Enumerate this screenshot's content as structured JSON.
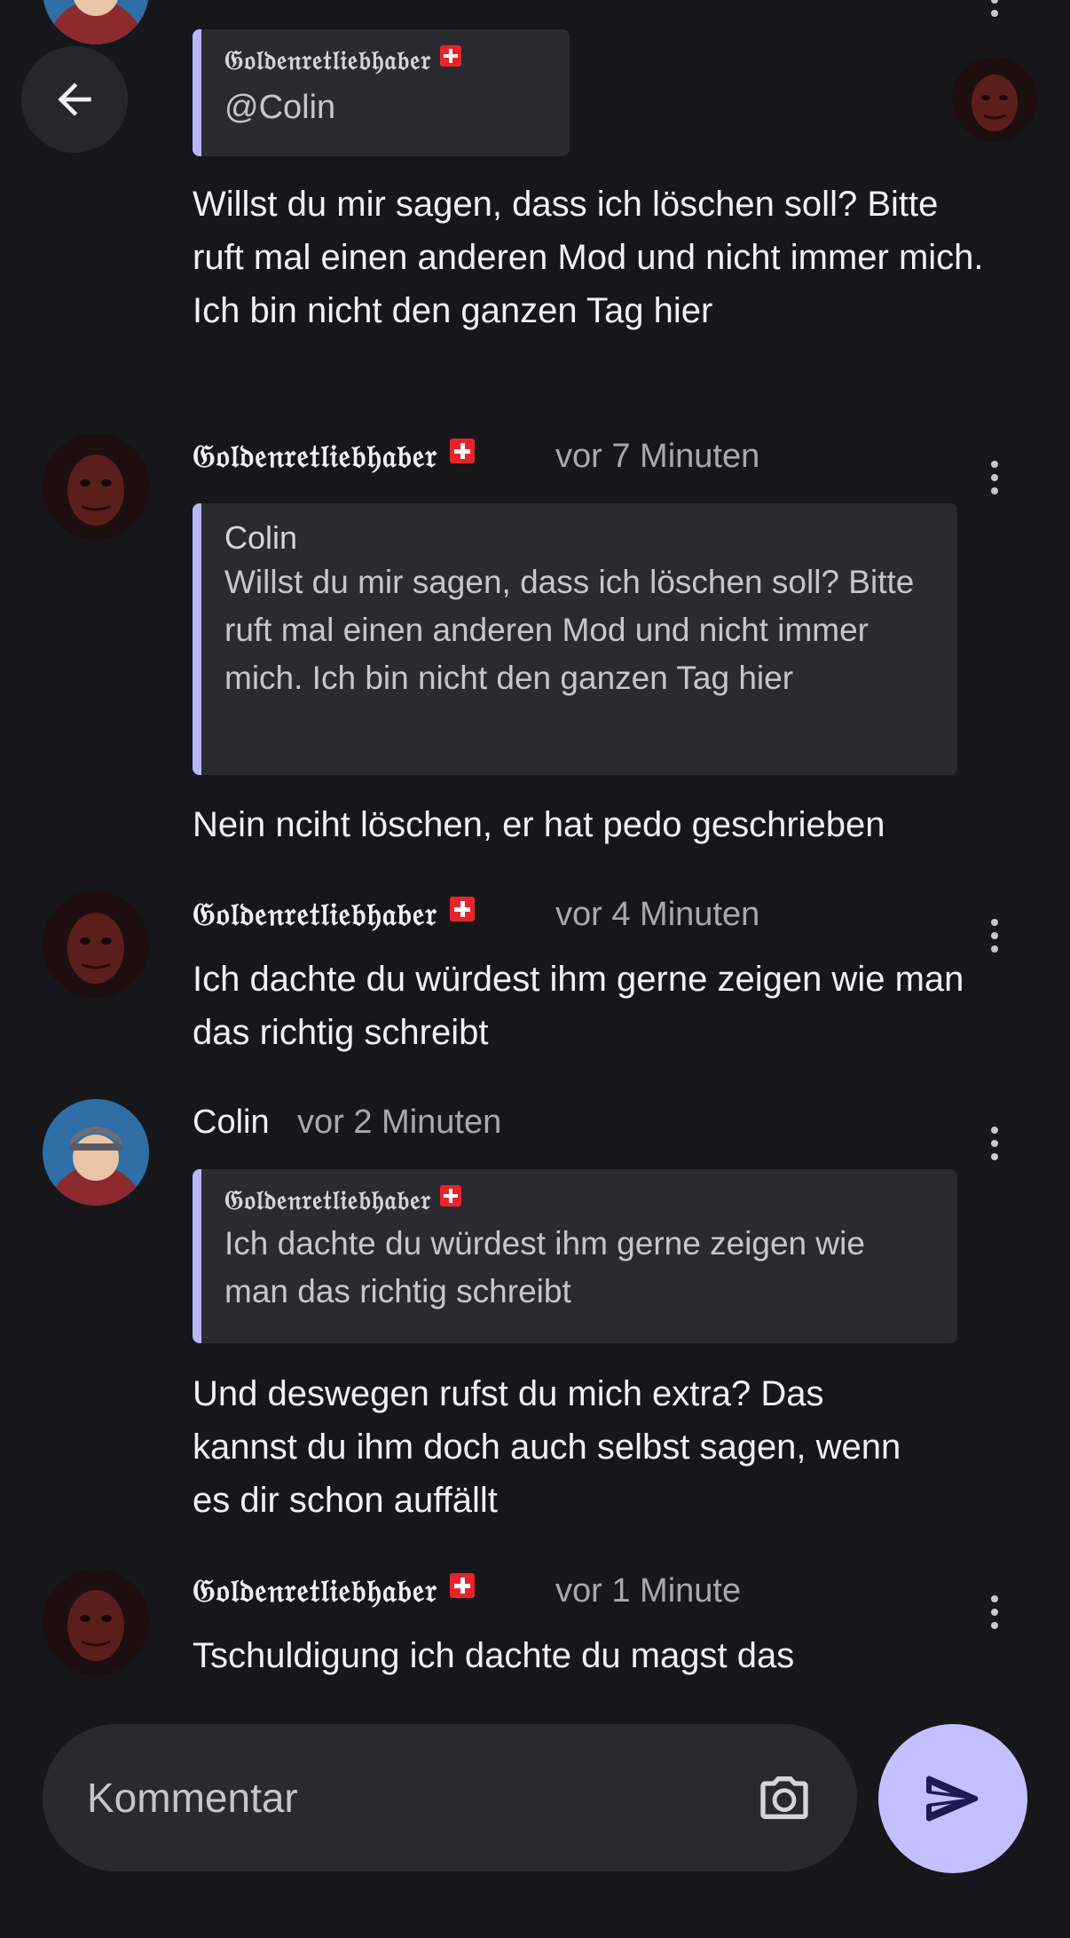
{
  "comments": [
    {
      "author": "𝔊𝔬𝔩𝔡𝔢𝔫𝔯𝔢𝔱𝔩𝔦𝔢𝔟𝔥𝔞𝔟𝔢𝔯",
      "quote_author": "𝔊𝔬𝔩𝔡𝔢𝔫𝔯𝔢𝔱𝔩𝔦𝔢𝔟𝔥𝔞𝔟𝔢𝔯",
      "quote_text": "@Colin",
      "text": "Willst du mir sagen, dass ich löschen soll? Bitte ruft mal einen anderen Mod und nicht immer mich. Ich bin nicht den ganzen Tag hier"
    },
    {
      "author": "𝔊𝔬𝔩𝔡𝔢𝔫𝔯𝔢𝔱𝔩𝔦𝔢𝔟𝔥𝔞𝔟𝔢𝔯",
      "time": "vor 7 Minuten",
      "quote_author": "Colin",
      "quote_text": "Willst du mir sagen, dass ich löschen soll? Bitte ruft mal einen anderen Mod und nicht immer mich. Ich bin nicht den ganzen Tag hier",
      "text": "Nein nciht löschen, er hat pedo geschrieben"
    },
    {
      "author": "𝔊𝔬𝔩𝔡𝔢𝔫𝔯𝔢𝔱𝔩𝔦𝔢𝔟𝔥𝔞𝔟𝔢𝔯",
      "time": "vor 4 Minuten",
      "text": "Ich dachte du würdest ihm gerne zeigen wie man das richtig schreibt"
    },
    {
      "author": "Colin",
      "time": "vor 2 Minuten",
      "quote_author": "𝔊𝔬𝔩𝔡𝔢𝔫𝔯𝔢𝔱𝔩𝔦𝔢𝔟𝔥𝔞𝔟𝔢𝔯",
      "quote_text": "Ich dachte du würdest ihm gerne zeigen wie man das richtig schreibt",
      "text": "Und deswegen rufst du mich extra? Das kannst du ihm doch auch selbst sagen, wenn es dir schon auffällt"
    },
    {
      "author": "𝔊𝔬𝔩𝔡𝔢𝔫𝔯𝔢𝔱𝔩𝔦𝔢𝔟𝔥𝔞𝔟𝔢𝔯",
      "time": "vor 1 Minute",
      "text": "Tschuldigung ich dachte du magst das"
    }
  ],
  "input": {
    "placeholder": "Kommentar"
  },
  "icons": {
    "back": "arrow-left-icon",
    "more": "more-vertical-icon",
    "camera": "camera-icon",
    "send": "send-icon",
    "flag": "swiss-flag-icon"
  },
  "colors": {
    "background": "#17171b",
    "quote_border": "#b9b6ff",
    "send_button": "#c3c0ff",
    "send_icon": "#1d1a52",
    "input_bg": "#2a292f"
  }
}
